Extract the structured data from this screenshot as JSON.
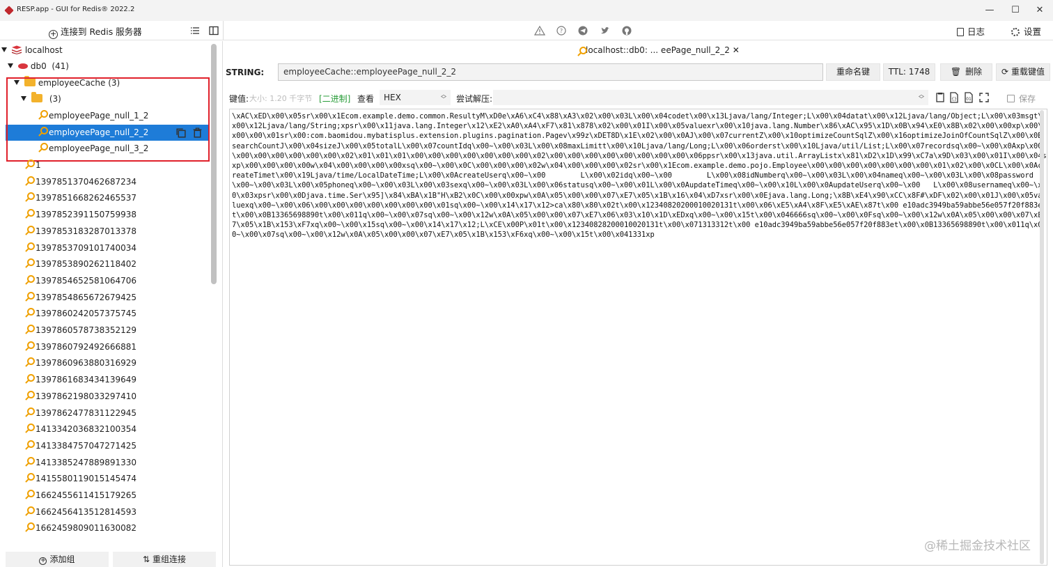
{
  "window": {
    "title": "RESP.app - GUI for Redis® 2022.2",
    "minimize": "—",
    "maximize": "☐",
    "close": "✕"
  },
  "left_toolbar": {
    "connect_label": "连接到 Redis 服务器"
  },
  "top_toolbar": {
    "logs_label": "日志",
    "settings_label": "设置"
  },
  "tree": {
    "server": "localhost",
    "db_name": "db0",
    "db_count": "(41)",
    "folder_name": "employeeCache",
    "folder_count": "(3)",
    "subfolder_count": "(3)",
    "nested_keys": [
      "employeePage_null_1_2",
      "employeePage_null_2_2",
      "employeePage_null_3_2"
    ],
    "keys": [
      "1",
      "1397851370462687234",
      "1397851668262465537",
      "1397852391150759938",
      "1397853183287013378",
      "1397853709101740034",
      "1397853890262118402",
      "1397854652581064706",
      "1397854865672679425",
      "1397860242057375745",
      "1397860578738352129",
      "1397860792492666881",
      "1397860963880316929",
      "1397861683434139649",
      "1397862198033297410",
      "1397862477831122945",
      "1413342036832100354",
      "1413384757047271425",
      "1413385247889891330",
      "1415580119015145474",
      "1662455611415179265",
      "1662456413512814593",
      "1662459809011630082"
    ]
  },
  "sidebar_bottom": {
    "add_group": "添加组",
    "regroup": "重组连接"
  },
  "tab": {
    "label": "localhost::db0: ... eePage_null_2_2",
    "close": "✕"
  },
  "key_row": {
    "type_label": "STRING:",
    "key_name": "employeeCache::employeePage_null_2_2",
    "rename_label": "重命名键",
    "ttl_label": "TTL:",
    "ttl_value": "1748",
    "delete_label": "删除",
    "reload_label": "重载键值"
  },
  "value_row": {
    "value_label": "键值:",
    "size_label": "大小: 1.20 千字节",
    "binary_label": "[二进制]",
    "view_label": "查看",
    "view_mode": "HEX",
    "decompress_label": "尝试解压:",
    "save_label": "保存"
  },
  "editor_lines": [
    "\\xAC\\xED\\x00\\x05sr\\x00\\x1Ecom.example.demo.common.ResultyM\\xD0e\\xA6\\xC4\\x88\\xA3\\x02\\x00\\x03L\\x00\\x04codet\\x00\\x13Ljava/lang/Integer;L\\x00\\x04datat\\x00\\x12Ljava/lang/Object;L\\x00\\x03msgt\\",
    "x00\\x12Ljava/lang/String;xpsr\\x00\\x11java.lang.Integer\\x12\\xE2\\xA0\\xA4\\xF7\\x81\\x878\\x02\\x00\\x01I\\x00\\x05valuexr\\x00\\x10java.lang.Number\\x86\\xAC\\x95\\x1D\\x0B\\x94\\xE0\\x8B\\x02\\x00\\x00xp\\x00\\",
    "x00\\x00\\x01sr\\x00:com.baomidou.mybatisplus.extension.plugins.pagination.Pagev\\x99z\\xDET8D\\x1E\\x02\\x00\\x0AJ\\x00\\x07currentZ\\x00\\x10optimizeCountSqlZ\\x00\\x16optimizeJoinOfCountSqlZ\\x00\\x0B",
    "searchCountJ\\x00\\x04sizeJ\\x00\\x05totalL\\x00\\x07countIdq\\x00~\\x00\\x03L\\x00\\x08maxLimitt\\x00\\x10Ljava/lang/Long;L\\x00\\x06orderst\\x00\\x10Ljava/util/List;L\\x00\\x07recordsq\\x00~\\x00\\x0Axp\\x00",
    "\\x00\\x00\\x00\\x00\\x00\\x00\\x02\\x01\\x01\\x01\\x00\\x00\\x00\\x00\\x00\\x00\\x00\\x02\\x00\\x00\\x00\\x00\\x00\\x00\\x00\\x00\\x06ppsr\\x00\\x13java.util.ArrayListx\\x81\\xD2\\x1D\\x99\\xC7a\\x9D\\x03\\x00\\x01I\\x00\\x04size",
    "xp\\x00\\x00\\x00\\x00w\\x04\\x00\\x00\\x00\\x00xsq\\x00~\\x00\\x0C\\x00\\x00\\x00\\x02w\\x04\\x00\\x00\\x00\\x02sr\\x00\\x1Ecom.example.demo.pojo.Employee\\x00\\x00\\x00\\x00\\x00\\x00\\x00\\x01\\x02\\x00\\x0CL\\x00\\x0Ac",
    "reateTimet\\x00\\x19Ljava/time/LocalDateTime;L\\x00\\x0AcreateUserq\\x00~\\x00        L\\x00\\x02idq\\x00~\\x00        L\\x00\\x08idNumberq\\x00~\\x00\\x03L\\x00\\x04nameq\\x00~\\x00\\x03L\\x00\\x08password",
    "\\x00~\\x00\\x03L\\x00\\x05phoneq\\x00~\\x00\\x03L\\x00\\x03sexq\\x00~\\x00\\x03L\\x00\\x06statusq\\x00~\\x00\\x01L\\x00\\x0AupdateTimeq\\x00~\\x00\\x10L\\x00\\x0AupdateUserq\\x00~\\x00   L\\x00\\x08usernameq\\x00~\\x",
    "0\\x03xpsr\\x00\\x0Djava.time.Ser\\x95]\\x84\\xBA\\x1B\"H\\xB2\\x0C\\x00\\x00xpw\\x0A\\x05\\x00\\x00\\x07\\xE7\\x05\\x1B\\x16\\x04\\xD7xsr\\x00\\x0Ejava.lang.Long;\\x8B\\xE4\\x90\\xCC\\x8F#\\xDF\\x02\\x00\\x01J\\x00\\x05va",
    "luexq\\x00~\\x00\\x06\\x00\\x00\\x00\\x00\\x00\\x00\\x00\\x01sq\\x00~\\x00\\x14\\x17\\x12>ca\\x80\\x80\\x02t\\x00\\x12340820200010020131t\\x00\\x06\\xE5\\xA4\\x8F\\xE5\\xAE\\x87t\\x00 e10adc3949ba59abbe56e057f20f883e",
    "t\\x00\\x0B13365698890t\\x00\\x011q\\x00~\\x00\\x07sq\\x00~\\x00\\x12w\\x0A\\x05\\x00\\x00\\x07\\xE7\\x06\\x03\\x10\\x1D\\xEDxq\\x00~\\x00\\x15t\\x00\\x046666sq\\x00~\\x00\\x0Fsq\\x00~\\x00\\x12w\\x0A\\x05\\x00\\x00\\x07\\xE",
    "7\\x05\\x1B\\x153\\xF7xq\\x00~\\x00\\x15sq\\x00~\\x00\\x14\\x17\\x12;L\\xCE\\x00P\\x01t\\x00\\x12340828200010020131t\\x00\\x071313312t\\x00 e10adc3949ba59abbe56e057f20f883et\\x00\\x0B13365698890t\\x00\\x011q\\x0",
    "0~\\x00\\x07sq\\x00~\\x00\\x12w\\x0A\\x05\\x00\\x00\\x07\\xE7\\x05\\x1B\\x153\\xF6xq\\x00~\\x00\\x15t\\x00\\x041331xp"
  ],
  "watermark": "@稀土掘金技术社区"
}
